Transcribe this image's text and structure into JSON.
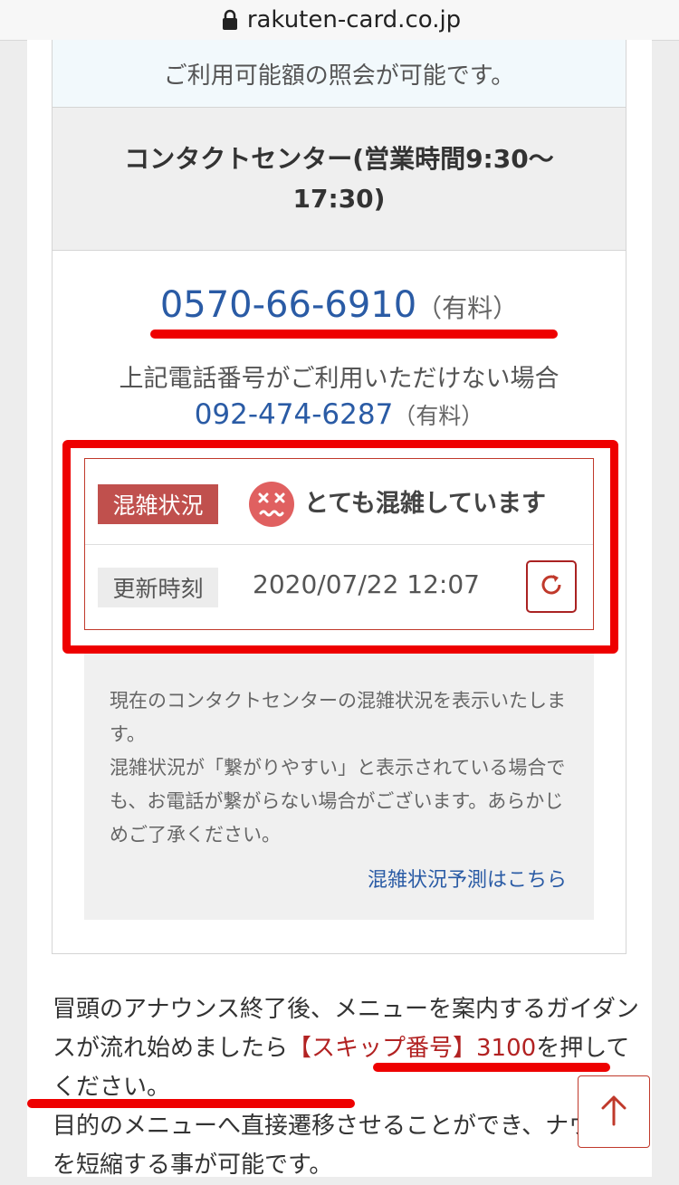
{
  "browser": {
    "url": "rakuten-card.co.jp"
  },
  "card": {
    "info_text": "ご利用可能額の照会が可能です。",
    "center_title": "コンタクトセンター(営業時間9:30〜17:30)",
    "phone_main": "0570-66-6910",
    "phone_main_fee": "（有料）",
    "alt_label": "上記電話番号がご利用いただけない場合",
    "phone_alt": "092-474-6287",
    "phone_alt_fee": "（有料）"
  },
  "status": {
    "congestion_label": "混雑状況",
    "congestion_value": "とても混雑しています",
    "updated_label": "更新時刻",
    "updated_value": "2020/07/22 12:07"
  },
  "note": {
    "text1": "現在のコンタクトセンターの混雑状況を表示いたします。",
    "text2": "混雑状況が「繋がりやすい」と表示されている場合でも、お電話が繋がらない場合がございます。あらかじめご了承ください。",
    "link": "混雑状況予測はこちら"
  },
  "body": {
    "line1": "冒頭のアナウンス終了後、メニューを案内するガイダンスが流れ始めましたら",
    "highlight": "【スキップ番号】3100",
    "line1_end": "を押してください。",
    "line2": "目的のメニューへ直接遷移させることができ、ナウンスを短縮する事が可能です。"
  },
  "colors": {
    "link_blue": "#2a5ba5",
    "accent_red": "#c0504d",
    "annotation_red": "#ee0000"
  }
}
